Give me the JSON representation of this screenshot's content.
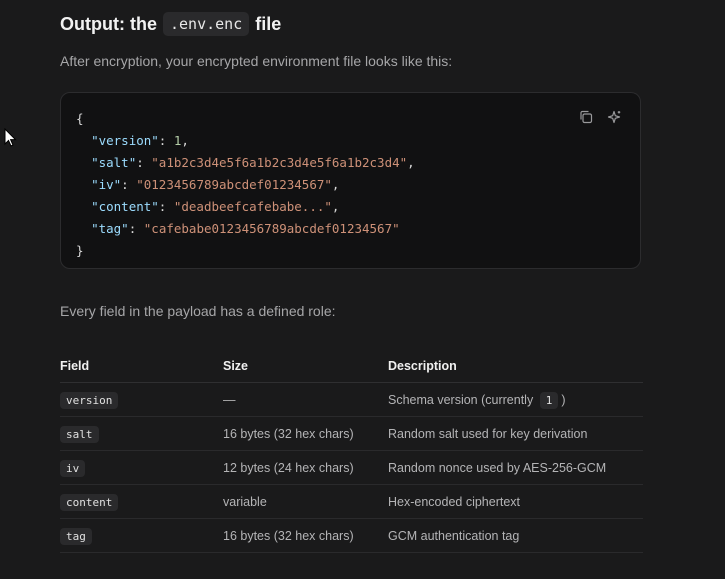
{
  "heading": {
    "prefix": "Output: the",
    "code": ".env.enc",
    "suffix": "file"
  },
  "intro_text": "After encryption, your encrypted environment file looks like this:",
  "code_block": {
    "actions": [
      {
        "icon": "copy-icon"
      },
      {
        "icon": "sparkle-icon"
      }
    ],
    "open_brace": "{",
    "close_brace": "}",
    "lines": [
      {
        "key": "\"version\"",
        "value": "1",
        "value_type": "number",
        "trailing": ","
      },
      {
        "key": "\"salt\"",
        "value": "\"a1b2c3d4e5f6a1b2c3d4e5f6a1b2c3d4\"",
        "value_type": "string",
        "trailing": ","
      },
      {
        "key": "\"iv\"",
        "value": "\"0123456789abcdef01234567\"",
        "value_type": "string",
        "trailing": ","
      },
      {
        "key": "\"content\"",
        "value": "\"deadbeefcafebabe...\"",
        "value_type": "string",
        "trailing": ","
      },
      {
        "key": "\"tag\"",
        "value": "\"cafebabe0123456789abcdef01234567\"",
        "value_type": "string",
        "trailing": ""
      }
    ]
  },
  "outro_text": "Every field in the payload has a defined role:",
  "table": {
    "headers": {
      "field": "Field",
      "size": "Size",
      "description": "Description"
    },
    "rows": [
      {
        "field": "version",
        "size": "—",
        "description": "Schema version (currently",
        "description_code": "1",
        "description_suffix": ")"
      },
      {
        "field": "salt",
        "size": "16 bytes (32 hex chars)",
        "description": "Random salt used for key derivation"
      },
      {
        "field": "iv",
        "size": "12 bytes (24 hex chars)",
        "description": "Random nonce used by AES-256-GCM"
      },
      {
        "field": "content",
        "size": "variable",
        "description": "Hex-encoded ciphertext"
      },
      {
        "field": "tag",
        "size": "16 bytes (32 hex chars)",
        "description": "GCM authentication tag"
      }
    ]
  },
  "colors": {
    "background": "#1a1a1b",
    "code_background": "#111112",
    "json_key": "#9cdcfe",
    "json_string": "#ce9178",
    "json_number": "#b5cea8"
  }
}
